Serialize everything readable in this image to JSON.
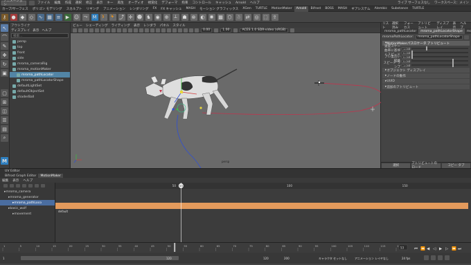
{
  "topmenu": {
    "workspace": "アニメーション",
    "menus": [
      "ファイル",
      "編集",
      "作成",
      "選択",
      "修正",
      "表示",
      "キー",
      "再生",
      "オーディオ",
      "視覚化",
      "デフォーマ",
      "拘束",
      "コントロール",
      "キャッシュ",
      "Arnold",
      "ヘルプ"
    ],
    "right_items": [
      "ワークスペース：メイン"
    ],
    "no_live_label": "ライブ サーフェスなし"
  },
  "shelf_tabs": [
    "カーブ/サーフェス",
    "ポリゴン モデリング",
    "スカルプト",
    "リギング",
    "アニメーション",
    "レンダリング",
    "FX",
    "FX キャッシュ",
    "MASH",
    "モーション グラフィックス",
    "XGen",
    "TURTLE",
    "MotionMaker",
    "Arnold",
    "Bifrost",
    "BOSS",
    "MASH",
    "ギアシステム",
    "Alembic",
    "Substance",
    "TURTLE"
  ],
  "outliner": {
    "title": "アウトライナ",
    "menus": [
      "ディスプレイ",
      "表示",
      "ヘルプ"
    ],
    "search_placeholder": "検索...",
    "items": [
      {
        "label": "persp",
        "selected": false,
        "indent": 0
      },
      {
        "label": "top",
        "selected": false,
        "indent": 0
      },
      {
        "label": "front",
        "selected": false,
        "indent": 0
      },
      {
        "label": "side",
        "selected": false,
        "indent": 0
      },
      {
        "label": "mroma_cameraRig",
        "selected": false,
        "indent": 0
      },
      {
        "label": "mroma_motionMaker",
        "selected": false,
        "indent": 0
      },
      {
        "label": "mroma_pathLocator",
        "selected": true,
        "indent": 1
      },
      {
        "label": "mroma_pathLocatorShape",
        "selected": false,
        "indent": 1
      },
      {
        "label": "defaultLightSet",
        "selected": false,
        "indent": 0
      },
      {
        "label": "defaultObjectSet",
        "selected": false,
        "indent": 0
      },
      {
        "label": "shaderBall",
        "selected": false,
        "indent": 0
      }
    ]
  },
  "viewport": {
    "menus": [
      "ビュー",
      "シェーディング",
      "ライティング",
      "表示",
      "レンダラ",
      "パネル",
      "スタイル"
    ],
    "field1": "0.00",
    "field2": "1.00",
    "colorspace": "ACES 1.0 SDR-video (sRGB)",
    "camera_label": "persp"
  },
  "attr_editor": {
    "tabs": [
      "リスト",
      "選択済み",
      "フォーカス",
      "アトリビュート",
      "ディスプレイ",
      "表示",
      "ヘルプ"
    ],
    "node_tabs": [
      {
        "label": "mroma_pathLocator",
        "active": false
      },
      {
        "label": "mroma_pathLocatorShape",
        "active": true
      },
      {
        "label": "motionPath",
        "active": false
      }
    ],
    "node_label": "mromaPathLocator:",
    "node_value": "mroma_pathLocatorShape",
    "sections": [
      {
        "label": "MotionMakerパスロケータ アトリビュート",
        "open": true
      },
      {
        "label": "オブジェクト ディスプレイ",
        "open": false
      },
      {
        "label": "ノードの動作",
        "open": false
      },
      {
        "label": "UUID",
        "open": false
      },
      {
        "label": "追加のアトリビュート",
        "open": false
      }
    ],
    "attrs": [
      {
        "label": "速度スケール",
        "value": "1.000",
        "level": 0.25
      },
      {
        "label": "曲率に基づくスピード",
        "value": "0.000",
        "level": 0.0
      },
      {
        "label": "ブレ度合い",
        "value": "0.000",
        "level": 0.0
      },
      {
        "label": "経路",
        "value": "0.000",
        "level": 0.72
      },
      {
        "label": "スピード ランプ",
        "value": "1.000",
        "level": 0.72
      }
    ],
    "buttons": [
      "選択",
      "アトリビュートのロード",
      "コピー タブ"
    ]
  },
  "bottom_tabs": [
    {
      "label": "UV Editor",
      "active": false
    },
    {
      "label": "Bifrost Graph Editor",
      "active": false
    },
    {
      "label": "MotionMaker",
      "active": true
    }
  ],
  "motionmaker": {
    "menus": [
      "編集",
      "表示",
      "ヘルプ"
    ],
    "ruler_labels": [
      {
        "label": "50",
        "frame": 50
      },
      {
        "label": "53",
        "frame": 53
      },
      {
        "label": "100",
        "frame": 100
      },
      {
        "label": "150",
        "frame": 150
      }
    ],
    "current_frame": "53",
    "tree": [
      {
        "label": "mroma_camera",
        "indent": 0,
        "selected": false
      },
      {
        "label": "mroma_generator",
        "indent": 1,
        "selected": false
      },
      {
        "label": "mroma_pathLoco",
        "indent": 2,
        "selected": true
      },
      {
        "label": "basic_wolf",
        "indent": 1,
        "selected": false
      },
      {
        "label": "movement",
        "indent": 2,
        "selected": false
      }
    ],
    "default_clip": "default"
  },
  "timeline": {
    "ticks": [
      "1",
      "5",
      "10",
      "15",
      "20",
      "25",
      "30",
      "35",
      "40",
      "45",
      "50",
      "55",
      "60",
      "65",
      "70",
      "75",
      "80",
      "85",
      "90",
      "95",
      "100",
      "105",
      "110",
      "115",
      "120"
    ],
    "current": "53",
    "range_start": "1",
    "range_inner_start": "1",
    "range_inner_end": "120",
    "range_end_a": "120",
    "range_end_b": "200",
    "fps": "24 fps",
    "no_char": "キャラクタ セットなし",
    "no_anim": "アニメーション レイヤなし"
  },
  "colors": {
    "selected_blue": "#5285a6",
    "path_red": "#c0344d",
    "clip_orange": "#e39a5c",
    "playhead_white": "#ffffff",
    "viewport_bg": "#6a6a6a"
  }
}
